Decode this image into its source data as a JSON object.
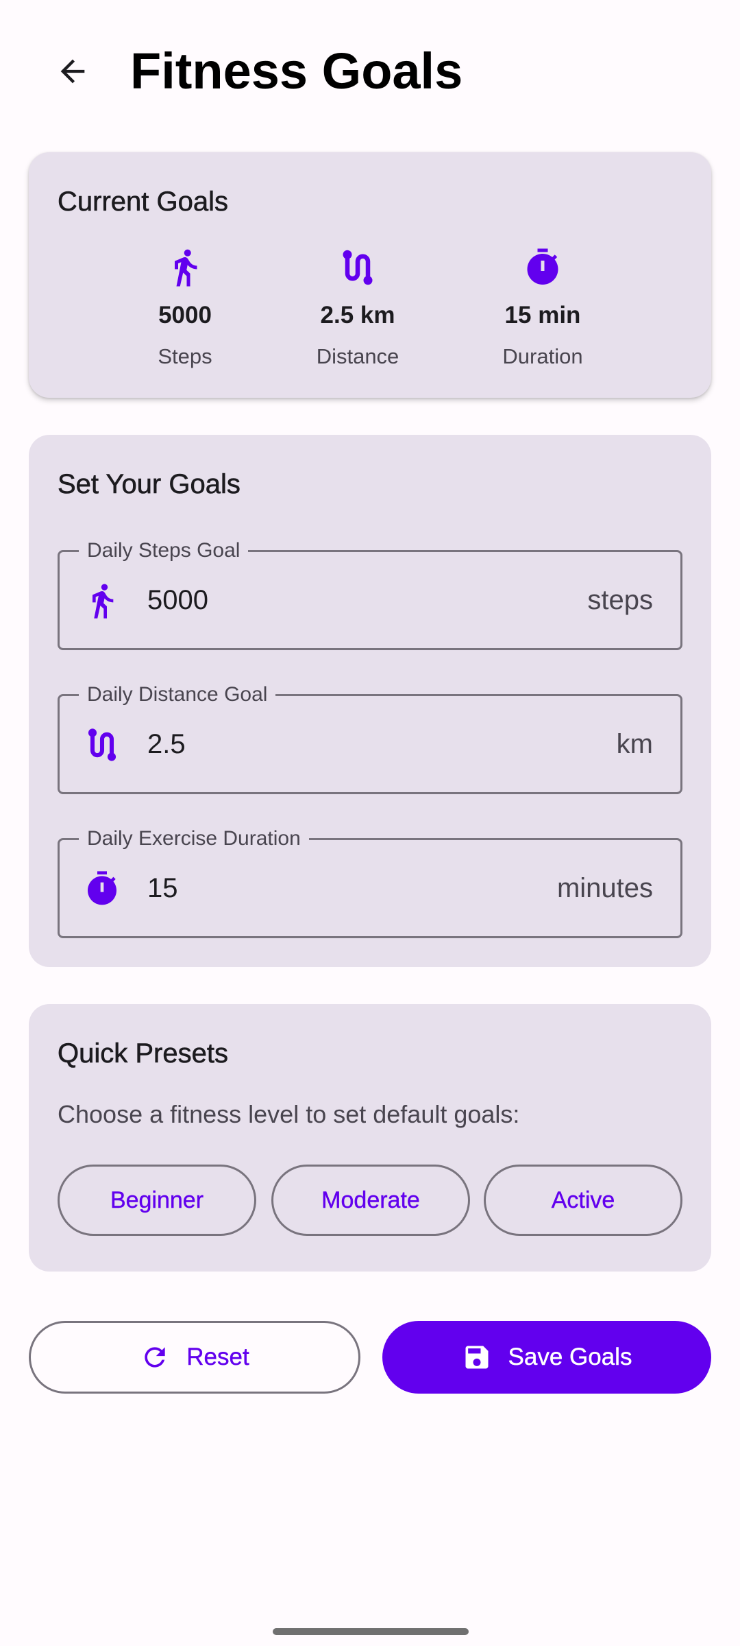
{
  "header": {
    "title": "Fitness Goals"
  },
  "current_goals": {
    "title": "Current Goals",
    "stats": [
      {
        "value": "5000",
        "label": "Steps"
      },
      {
        "value": "2.5 km",
        "label": "Distance"
      },
      {
        "value": "15 min",
        "label": "Duration"
      }
    ]
  },
  "set_goals": {
    "title": "Set Your Goals",
    "fields": [
      {
        "label": "Daily Steps Goal",
        "value": "5000",
        "suffix": "steps"
      },
      {
        "label": "Daily Distance Goal",
        "value": "2.5",
        "suffix": "km"
      },
      {
        "label": "Daily Exercise Duration",
        "value": "15",
        "suffix": "minutes"
      }
    ]
  },
  "presets": {
    "title": "Quick Presets",
    "description": "Choose a fitness level to set default goals:",
    "options": [
      "Beginner",
      "Moderate",
      "Active"
    ]
  },
  "actions": {
    "reset_label": "Reset",
    "save_label": "Save Goals"
  },
  "colors": {
    "accent": "#6200EE",
    "card": "#E7E0EC",
    "outline": "#79747E"
  }
}
